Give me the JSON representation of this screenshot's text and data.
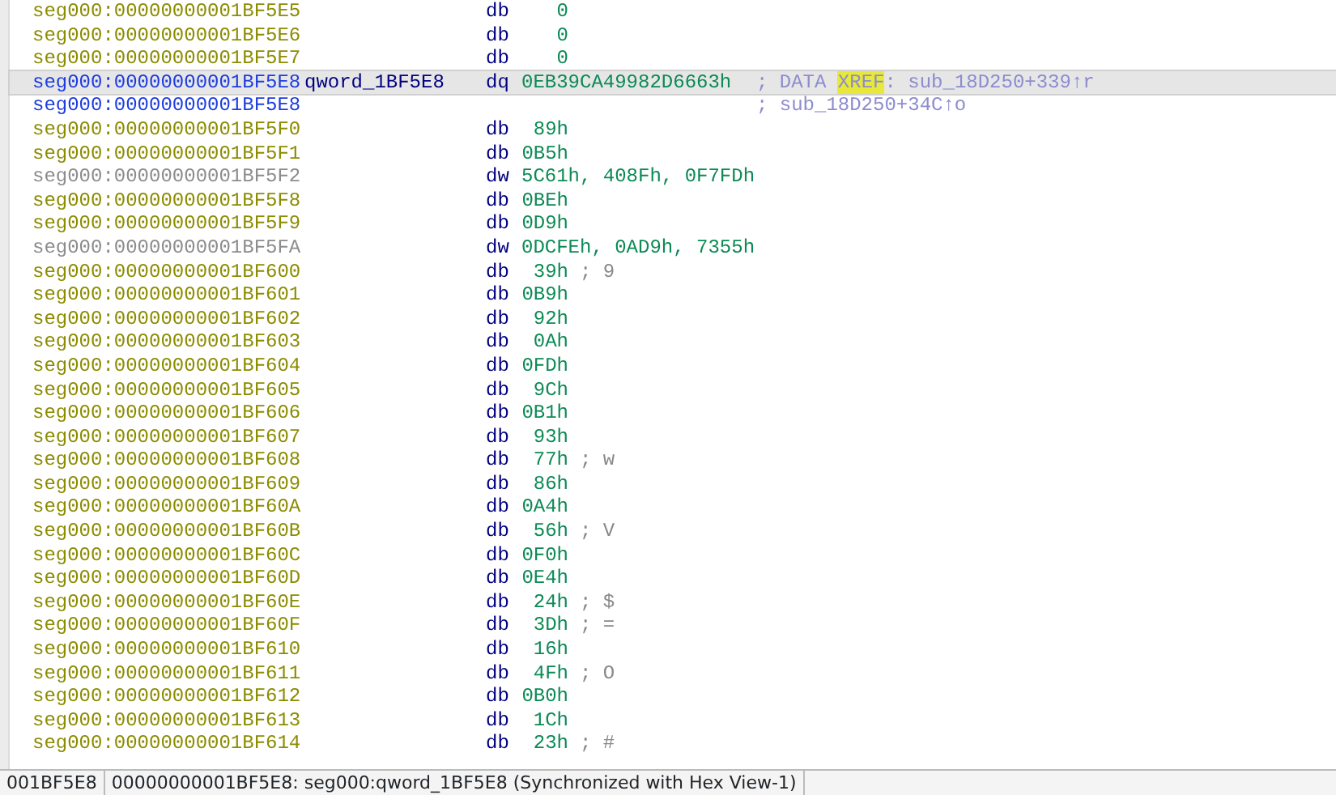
{
  "listing": [
    {
      "address": "seg000:00000000001BF5E5",
      "kind": "data",
      "selected": false,
      "mnemonic": "db",
      "operand": "0",
      "padded": true
    },
    {
      "address": "seg000:00000000001BF5E6",
      "kind": "data",
      "selected": false,
      "mnemonic": "db",
      "operand": "0",
      "padded": true
    },
    {
      "address": "seg000:00000000001BF5E7",
      "kind": "data",
      "selected": false,
      "mnemonic": "db",
      "operand": "0",
      "padded": true
    },
    {
      "address": "seg000:00000000001BF5E8",
      "kind": "named",
      "selected": true,
      "label": "qword_1BF5E8",
      "mnemonic": "dq",
      "operand": "0EB39CA49982D6663h",
      "padded": false,
      "xref": [
        {
          "text": "; DATA ",
          "highlighted": false
        },
        {
          "text": "XREF",
          "highlighted": true
        },
        {
          "text": ": sub_18D250+339↑r",
          "highlighted": false
        }
      ]
    },
    {
      "address": "seg000:00000000001BF5E8",
      "kind": "named",
      "selected": false,
      "xref": [
        {
          "text": "; sub_18D250+34C↑o",
          "highlighted": false
        }
      ]
    },
    {
      "address": "seg000:00000000001BF5F0",
      "kind": "data",
      "selected": false,
      "mnemonic": "db",
      "operand": "89h",
      "padded": true
    },
    {
      "address": "seg000:00000000001BF5F1",
      "kind": "data",
      "selected": false,
      "mnemonic": "db",
      "operand": "0B5h",
      "padded": true
    },
    {
      "address": "seg000:00000000001BF5F2",
      "kind": "unexplored",
      "selected": false,
      "mnemonic": "dw",
      "operand": "5C61h, 408Fh, 0F7FDh",
      "padded": false
    },
    {
      "address": "seg000:00000000001BF5F8",
      "kind": "data",
      "selected": false,
      "mnemonic": "db",
      "operand": "0BEh",
      "padded": true
    },
    {
      "address": "seg000:00000000001BF5F9",
      "kind": "data",
      "selected": false,
      "mnemonic": "db",
      "operand": "0D9h",
      "padded": true
    },
    {
      "address": "seg000:00000000001BF5FA",
      "kind": "unexplored",
      "selected": false,
      "mnemonic": "dw",
      "operand": "0DCFEh, 0AD9h, 7355h",
      "padded": false
    },
    {
      "address": "seg000:00000000001BF600",
      "kind": "data",
      "selected": false,
      "mnemonic": "db",
      "operand": "39h",
      "padded": true,
      "comment": "; 9"
    },
    {
      "address": "seg000:00000000001BF601",
      "kind": "data",
      "selected": false,
      "mnemonic": "db",
      "operand": "0B9h",
      "padded": true
    },
    {
      "address": "seg000:00000000001BF602",
      "kind": "data",
      "selected": false,
      "mnemonic": "db",
      "operand": "92h",
      "padded": true
    },
    {
      "address": "seg000:00000000001BF603",
      "kind": "data",
      "selected": false,
      "mnemonic": "db",
      "operand": "0Ah",
      "padded": true
    },
    {
      "address": "seg000:00000000001BF604",
      "kind": "data",
      "selected": false,
      "mnemonic": "db",
      "operand": "0FDh",
      "padded": true
    },
    {
      "address": "seg000:00000000001BF605",
      "kind": "data",
      "selected": false,
      "mnemonic": "db",
      "operand": "9Ch",
      "padded": true
    },
    {
      "address": "seg000:00000000001BF606",
      "kind": "data",
      "selected": false,
      "mnemonic": "db",
      "operand": "0B1h",
      "padded": true
    },
    {
      "address": "seg000:00000000001BF607",
      "kind": "data",
      "selected": false,
      "mnemonic": "db",
      "operand": "93h",
      "padded": true
    },
    {
      "address": "seg000:00000000001BF608",
      "kind": "data",
      "selected": false,
      "mnemonic": "db",
      "operand": "77h",
      "padded": true,
      "comment": "; w"
    },
    {
      "address": "seg000:00000000001BF609",
      "kind": "data",
      "selected": false,
      "mnemonic": "db",
      "operand": "86h",
      "padded": true
    },
    {
      "address": "seg000:00000000001BF60A",
      "kind": "data",
      "selected": false,
      "mnemonic": "db",
      "operand": "0A4h",
      "padded": true
    },
    {
      "address": "seg000:00000000001BF60B",
      "kind": "data",
      "selected": false,
      "mnemonic": "db",
      "operand": "56h",
      "padded": true,
      "comment": "; V"
    },
    {
      "address": "seg000:00000000001BF60C",
      "kind": "data",
      "selected": false,
      "mnemonic": "db",
      "operand": "0F0h",
      "padded": true
    },
    {
      "address": "seg000:00000000001BF60D",
      "kind": "data",
      "selected": false,
      "mnemonic": "db",
      "operand": "0E4h",
      "padded": true
    },
    {
      "address": "seg000:00000000001BF60E",
      "kind": "data",
      "selected": false,
      "mnemonic": "db",
      "operand": "24h",
      "padded": true,
      "comment": "; $"
    },
    {
      "address": "seg000:00000000001BF60F",
      "kind": "data",
      "selected": false,
      "mnemonic": "db",
      "operand": "3Dh",
      "padded": true,
      "comment": "; ="
    },
    {
      "address": "seg000:00000000001BF610",
      "kind": "data",
      "selected": false,
      "mnemonic": "db",
      "operand": "16h",
      "padded": true
    },
    {
      "address": "seg000:00000000001BF611",
      "kind": "data",
      "selected": false,
      "mnemonic": "db",
      "operand": "4Fh",
      "padded": true,
      "comment": "; O"
    },
    {
      "address": "seg000:00000000001BF612",
      "kind": "data",
      "selected": false,
      "mnemonic": "db",
      "operand": "0B0h",
      "padded": true
    },
    {
      "address": "seg000:00000000001BF613",
      "kind": "data",
      "selected": false,
      "mnemonic": "db",
      "operand": "1Ch",
      "padded": true
    },
    {
      "address": "seg000:00000000001BF614",
      "kind": "data",
      "selected": false,
      "mnemonic": "db",
      "operand": "23h",
      "padded": true,
      "comment": "; #"
    }
  ],
  "status_bar": {
    "offset": "001BF5E8",
    "location": "00000000001BF5E8: seg000:qword_1BF5E8 (Synchronized with Hex View-1)"
  }
}
